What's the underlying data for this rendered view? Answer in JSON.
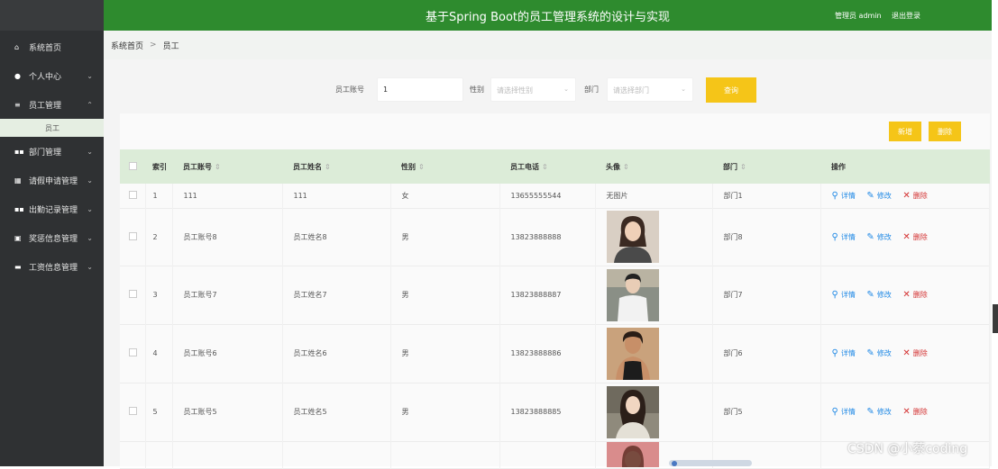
{
  "app": {
    "title": "基于Spring Boot的员工管理系统的设计与实现",
    "user_label": "管理员 admin",
    "logout_label": "退出登录"
  },
  "sidebar": {
    "items": [
      {
        "label": "系统首页",
        "icon": "home-icon",
        "expandable": false
      },
      {
        "label": "个人中心",
        "icon": "user-icon",
        "expandable": true
      },
      {
        "label": "员工管理",
        "icon": "list-icon",
        "expandable": true,
        "expanded": true
      },
      {
        "label": "部门管理",
        "icon": "grid-icon",
        "expandable": true
      },
      {
        "label": "请假申请管理",
        "icon": "table-icon",
        "expandable": true
      },
      {
        "label": "出勤记录管理",
        "icon": "grid-icon",
        "expandable": true
      },
      {
        "label": "奖惩信息管理",
        "icon": "chart-icon",
        "expandable": true
      },
      {
        "label": "工资信息管理",
        "icon": "wallet-icon",
        "expandable": true
      }
    ],
    "sub_item": "员工"
  },
  "breadcrumb": {
    "home": "系统首页",
    "separator": ">",
    "current": "员工"
  },
  "search": {
    "account_label": "员工账号",
    "account_value": "1",
    "gender_label": "性别",
    "gender_placeholder": "请选择性别",
    "dept_label": "部门",
    "dept_placeholder": "请选择部门",
    "query_button": "查询"
  },
  "toolbar": {
    "add_label": "新增",
    "delete_label": "删除"
  },
  "table": {
    "headers": {
      "index": "索引",
      "account": "员工账号",
      "name": "员工姓名",
      "gender": "性别",
      "phone": "员工电话",
      "avatar": "头像",
      "dept": "部门",
      "ops": "操作"
    },
    "rows": [
      {
        "index": "1",
        "account": "111",
        "name": "111",
        "gender": "女",
        "phone": "13655555544",
        "avatar": "无图片",
        "dept": "部门1"
      },
      {
        "index": "2",
        "account": "员工账号8",
        "name": "员工姓名8",
        "gender": "男",
        "phone": "13823888888",
        "avatar": "",
        "dept": "部门8"
      },
      {
        "index": "3",
        "account": "员工账号7",
        "name": "员工姓名7",
        "gender": "男",
        "phone": "13823888887",
        "avatar": "",
        "dept": "部门7"
      },
      {
        "index": "4",
        "account": "员工账号6",
        "name": "员工姓名6",
        "gender": "男",
        "phone": "13823888886",
        "avatar": "",
        "dept": "部门6"
      },
      {
        "index": "5",
        "account": "员工账号5",
        "name": "员工姓名5",
        "gender": "男",
        "phone": "13823888885",
        "avatar": "",
        "dept": "部门5"
      }
    ],
    "ops": {
      "detail": "详情",
      "edit": "修改",
      "delete": "删除"
    }
  },
  "watermark": "CSDN @小蔡coding",
  "colors": {
    "header_green": "#2e8b2e",
    "sidebar_dark": "#2f3133",
    "accent_yellow": "#f5c518",
    "table_head": "#dcecd8"
  }
}
